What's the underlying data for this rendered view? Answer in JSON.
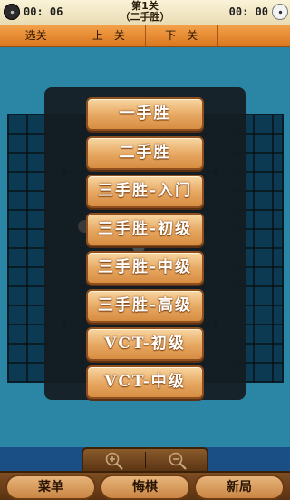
{
  "top_bar": {
    "timer_left": "00: 06",
    "timer_right": "00: 00",
    "level_line1": "第1关",
    "level_line2": "（二手胜）"
  },
  "nav": {
    "select_level": "选关",
    "prev_level": "上一关",
    "next_level": "下一关",
    "extra": ""
  },
  "menu": {
    "items": [
      "一手胜",
      "二手胜",
      "三手胜-入门",
      "三手胜-初级",
      "三手胜-中级",
      "三手胜-高级",
      "VCT-初级",
      "VCT-中级"
    ]
  },
  "zoom": {
    "zoom_in_icon": "magnifier-plus-icon",
    "zoom_out_icon": "magnifier-minus-icon"
  },
  "bottom_bar": {
    "menu_label": "菜单",
    "undo_label": "悔棋",
    "new_game_label": "新局"
  },
  "colors": {
    "field": "#2b86a6",
    "nav": "#e58c33",
    "button": "#e6a660",
    "bottom": "#6b3f18"
  }
}
